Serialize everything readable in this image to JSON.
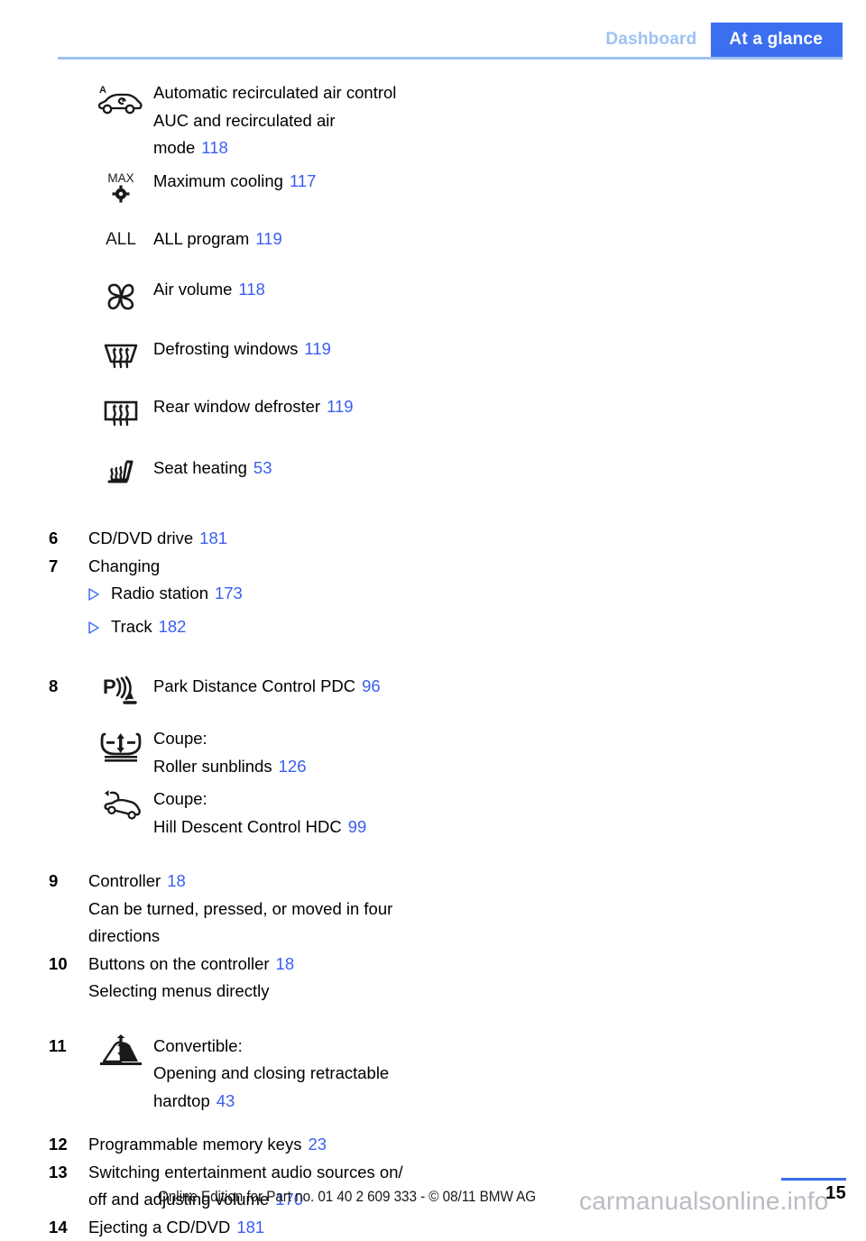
{
  "header": {
    "tab_inactive": "Dashboard",
    "tab_active": "At a glance",
    "accent_blue": "#3b6ff0",
    "light_blue": "#9dc2f2"
  },
  "climate_items": [
    {
      "icon": "auc-car-recirculation-icon",
      "lines": [
        "Automatic recirculated air control",
        "AUC and recirculated air",
        "mode"
      ],
      "page": "118"
    },
    {
      "icon": "max-cooling-icon",
      "lines": [
        "Maximum cooling"
      ],
      "page": "117"
    },
    {
      "icon": "all-program-icon",
      "lines": [
        "ALL program"
      ],
      "page": "119"
    },
    {
      "icon": "fan-air-volume-icon",
      "lines": [
        "Air volume"
      ],
      "page": "118"
    },
    {
      "icon": "windshield-defrost-icon",
      "lines": [
        "Defrosting windows"
      ],
      "page": "119"
    },
    {
      "icon": "rear-window-defroster-icon",
      "lines": [
        "Rear window defroster"
      ],
      "page": "119"
    },
    {
      "icon": "seat-heating-icon",
      "lines": [
        "Seat heating"
      ],
      "page": "53"
    }
  ],
  "numbered_items": {
    "item6": {
      "number": "6",
      "label": "CD/DVD drive",
      "page": "181"
    },
    "item7": {
      "number": "7",
      "label": "Changing"
    },
    "item7_bullets": [
      {
        "label": "Radio station",
        "page": "173"
      },
      {
        "label": "Track",
        "page": "182"
      }
    ],
    "item8": {
      "number": "8"
    },
    "item8_rows": [
      {
        "icon": "pdc-park-distance-icon",
        "lines": [
          "Park Distance Control PDC"
        ],
        "page": "96"
      },
      {
        "icon": "roller-sunblind-icon",
        "lines": [
          "Coupe:",
          "Roller sunblinds"
        ],
        "page": "126"
      },
      {
        "icon": "hill-descent-control-icon",
        "lines": [
          "Coupe:",
          "Hill Descent Control HDC"
        ],
        "page": "99"
      }
    ],
    "item9": {
      "number": "9",
      "label": "Controller",
      "page": "18",
      "sub_lines": [
        "Can be turned, pressed, or moved in four",
        "directions"
      ]
    },
    "item10": {
      "number": "10",
      "label": "Buttons on the controller",
      "page": "18",
      "sub_lines": [
        "Selecting menus directly"
      ]
    },
    "item11": {
      "number": "11",
      "icon": "convertible-hardtop-icon",
      "lines": [
        "Convertible:",
        "Opening and closing retractable",
        "hardtop"
      ],
      "page": "43"
    },
    "item12": {
      "number": "12",
      "label": "Programmable memory keys",
      "page": "23"
    },
    "item13": {
      "number": "13",
      "lines": [
        "Switching entertainment audio sources on/",
        "off and adjusting volume"
      ],
      "page": "170"
    },
    "item14": {
      "number": "14",
      "label": "Ejecting a CD/DVD",
      "page": "181"
    }
  },
  "footer": {
    "online_edition": "Online Edition for Part no. 01 40 2 609 333 - © 08/11 BMW AG",
    "watermark": "carmanualsonline.info",
    "page_number": "15"
  }
}
